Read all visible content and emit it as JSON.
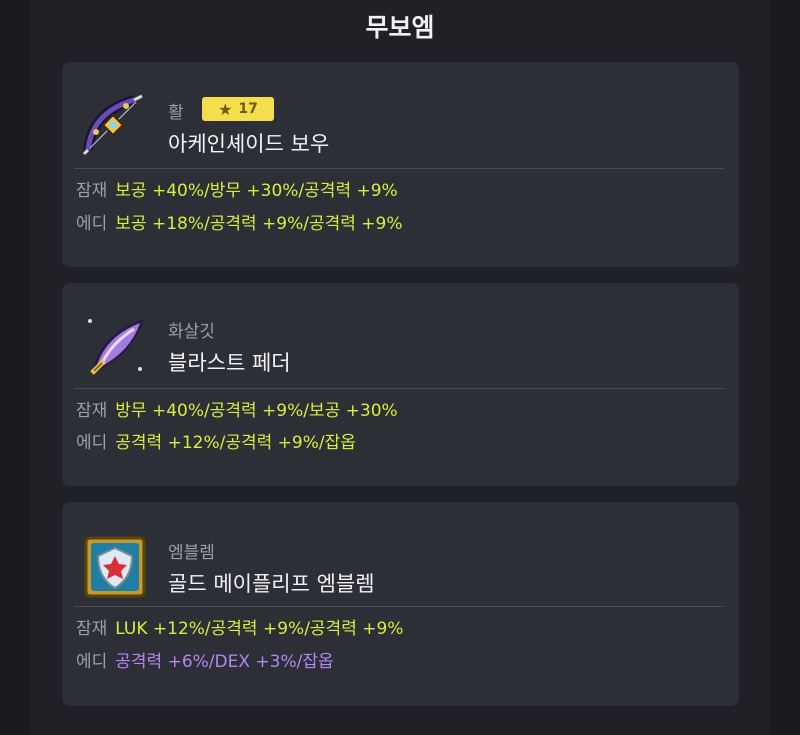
{
  "page": {
    "title": "무보엠"
  },
  "colors": {
    "legendary_option": "#d6ef3c",
    "epic_option": "#b486f2",
    "star_badge": "#f5de4e"
  },
  "items": [
    {
      "category": "활",
      "stars": "17",
      "name": "아케인셰이드 보우",
      "icon": "bow-icon",
      "potential_label": "잠재",
      "potential": "보공 +40%/방무 +30%/공격력 +9%",
      "additional_label": "에디",
      "additional": "보공 +18%/공격력 +9%/공격력 +9%"
    },
    {
      "category": "화살깃",
      "name": "블라스트 페더",
      "icon": "feather-icon",
      "potential_label": "잠재",
      "potential": "방무 +40%/공격력 +9%/보공 +30%",
      "additional_label": "에디",
      "additional": "공격력 +12%/공격력 +9%/잡옵"
    },
    {
      "category": "엠블렘",
      "name": "골드 메이플리프 엠블렘",
      "icon": "emblem-icon",
      "potential_label": "잠재",
      "potential": "LUK +12%/공격력 +9%/공격력 +9%",
      "additional_label": "에디",
      "additional": "공격력 +6%/DEX +3%/잡옵"
    }
  ]
}
